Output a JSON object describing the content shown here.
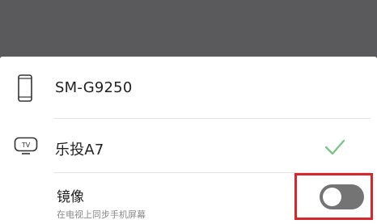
{
  "devices": [
    {
      "name": "SM-G9250",
      "icon": "phone-icon",
      "selected": false
    },
    {
      "name": "乐投A7",
      "icon": "tv-icon",
      "selected": true
    }
  ],
  "mirror": {
    "title": "镜像",
    "subtitle": "在电视上同步手机屏幕",
    "enabled": false
  },
  "colors": {
    "overlay": "#5a5a5c",
    "check": "#7cc48a",
    "highlight": "#d8262c",
    "toggle_off": "#747474"
  }
}
